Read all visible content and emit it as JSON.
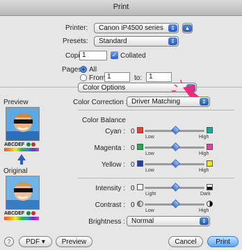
{
  "window": {
    "title": "Print"
  },
  "printer": {
    "label": "Printer:",
    "value": "Canon iP4500 series"
  },
  "presets": {
    "label": "Presets:",
    "value": "Standard"
  },
  "copies": {
    "label": "Copies:",
    "value": "1",
    "collated_label": "Collated"
  },
  "pages": {
    "label": "Pages:",
    "all_label": "All",
    "from_label": "From:",
    "from_value": "1",
    "to_label": "to:",
    "to_value": "1"
  },
  "panel_popup": {
    "value": "Color Options"
  },
  "color_correction": {
    "label": "Color Correction :",
    "value": "Driver Matching"
  },
  "preview": {
    "label": "Preview",
    "original_label": "Original",
    "sample_text": "ABCDEF"
  },
  "color_balance": {
    "heading": "Color Balance",
    "rows": [
      {
        "label": "Cyan :",
        "value": "0",
        "low": "Low",
        "high": "High",
        "left_color": "#e0452a",
        "right_color": "#1aa89a"
      },
      {
        "label": "Magenta :",
        "value": "0",
        "low": "Low",
        "high": "High",
        "left_color": "#2aa84a",
        "right_color": "#d04aa0"
      },
      {
        "label": "Yellow :",
        "value": "0",
        "low": "Low",
        "high": "High",
        "left_color": "#1f3fa8",
        "right_color": "#f2e01a"
      }
    ]
  },
  "intensity": {
    "label": "Intensity :",
    "value": "0",
    "low": "Light",
    "high": "Dark"
  },
  "contrast": {
    "label": "Contrast :",
    "value": "0",
    "low": "Low",
    "high": "High"
  },
  "brightness": {
    "label": "Brightness :",
    "value": "Normal"
  },
  "footer": {
    "help": "?",
    "pdf": "PDF ▾",
    "preview": "Preview",
    "cancel": "Cancel",
    "print": "Print"
  }
}
